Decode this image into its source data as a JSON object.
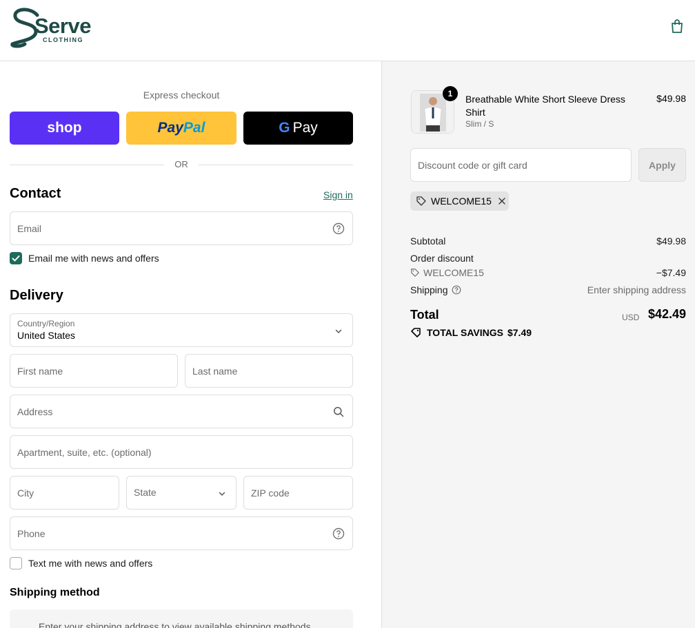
{
  "brand": {
    "name": "Serve",
    "sub": "CLOTHING",
    "color": "#1e4a47"
  },
  "express": {
    "title": "Express checkout",
    "shop_label": "shop",
    "paypal_a": "Pay",
    "paypal_b": "Pal",
    "gpay_g": "G",
    "gpay_label": "Pay",
    "or_label": "OR"
  },
  "contact": {
    "title": "Contact",
    "signin": "Sign in",
    "email_placeholder": "Email",
    "news_label": "Email me with news and offers",
    "news_checked": true
  },
  "delivery": {
    "title": "Delivery",
    "country_label": "Country/Region",
    "country_value": "United States",
    "first_name": "First name",
    "last_name": "Last name",
    "address": "Address",
    "apartment": "Apartment, suite, etc. (optional)",
    "city": "City",
    "state": "State",
    "zip": "ZIP code",
    "phone": "Phone",
    "sms_label": "Text me with news and offers",
    "sms_checked": false
  },
  "shipping": {
    "title": "Shipping method",
    "message": "Enter your shipping address to view available shipping methods."
  },
  "summary": {
    "item": {
      "quantity": "1",
      "name": "Breathable White Short Sleeve Dress Shirt",
      "variant": "Slim / S",
      "price": "$49.98"
    },
    "discount_placeholder": "Discount code or gift card",
    "apply_label": "Apply",
    "applied_code": "WELCOME15",
    "subtotal_label": "Subtotal",
    "subtotal_value": "$49.98",
    "order_discount_label": "Order discount",
    "discount_code": "WELCOME15",
    "discount_value": "−$7.49",
    "shipping_label": "Shipping",
    "shipping_value": "Enter shipping address",
    "total_label": "Total",
    "currency": "USD",
    "total_value": "$42.49",
    "savings_label": "TOTAL SAVINGS",
    "savings_value": "$7.49"
  },
  "colors": {
    "accent": "#1e6b5c",
    "shop": "#5a31f4",
    "paypal": "#ffc439",
    "gpay": "#000000"
  }
}
